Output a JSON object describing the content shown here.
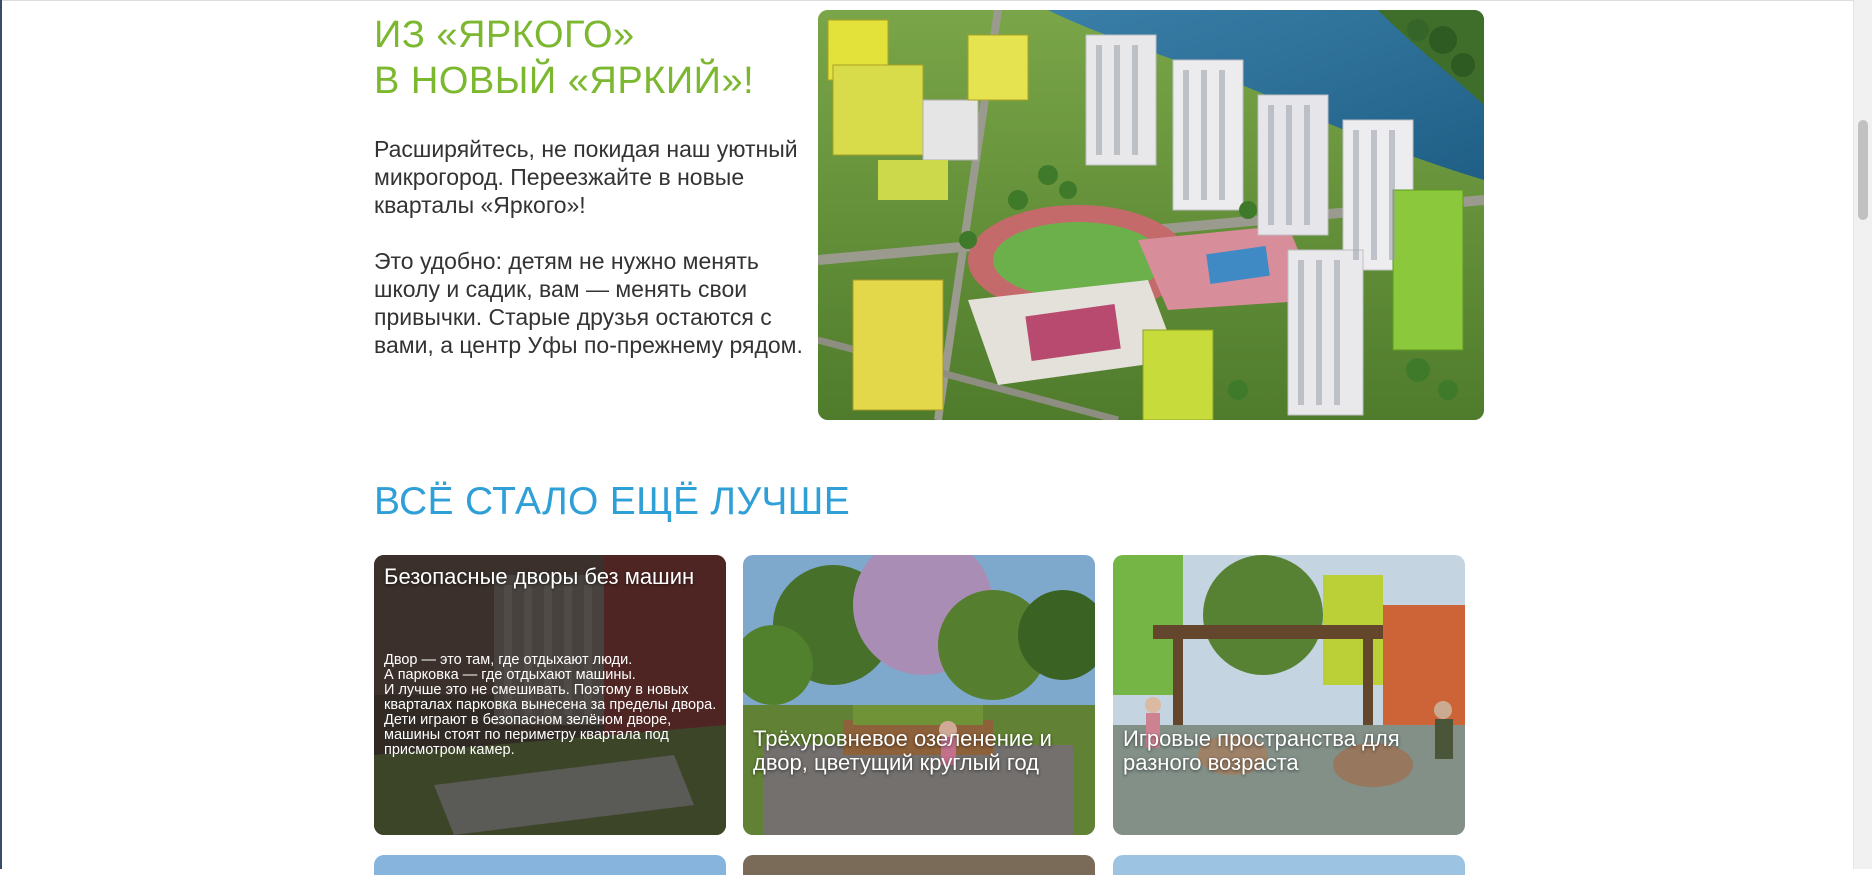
{
  "hero": {
    "title_line1": "ИЗ «ЯРКОГО»",
    "title_line2": "В НОВЫЙ «ЯРКИЙ»!",
    "paragraph1": "Расширяйтесь, не покидая наш уютный микрогород. Переезжайте в новые кварталы «Яркого»!",
    "paragraph2": "Это удобно: детям не нужно менять школу и садик, вам — менять свои привычки. Старые друзья остаются с вами, а центр Уфы по-прежнему рядом."
  },
  "features": {
    "title": "ВСЁ СТАЛО ЕЩЁ ЛУЧШЕ",
    "cards": [
      {
        "title": "Безопасные дворы без машин",
        "description_lines": [
          "Двор — это там, где отдыхают люди.",
          "А парковка — где отдыхают машины.",
          "И лучше это не смешивать. Поэтому в новых кварталах парковка вынесена за пределы двора. Дети играют в безопасном зелёном дворе, машины стоят по периметру квартала под присмотром камер."
        ]
      },
      {
        "title": "Трёхуровневое озеленение и двор, цветущий круглый год"
      },
      {
        "title": "Игровые пространства для разного возраста"
      }
    ]
  },
  "colors": {
    "hero_title": "#7cb82f",
    "section_title": "#2f9fd8",
    "body_text": "#333333"
  }
}
